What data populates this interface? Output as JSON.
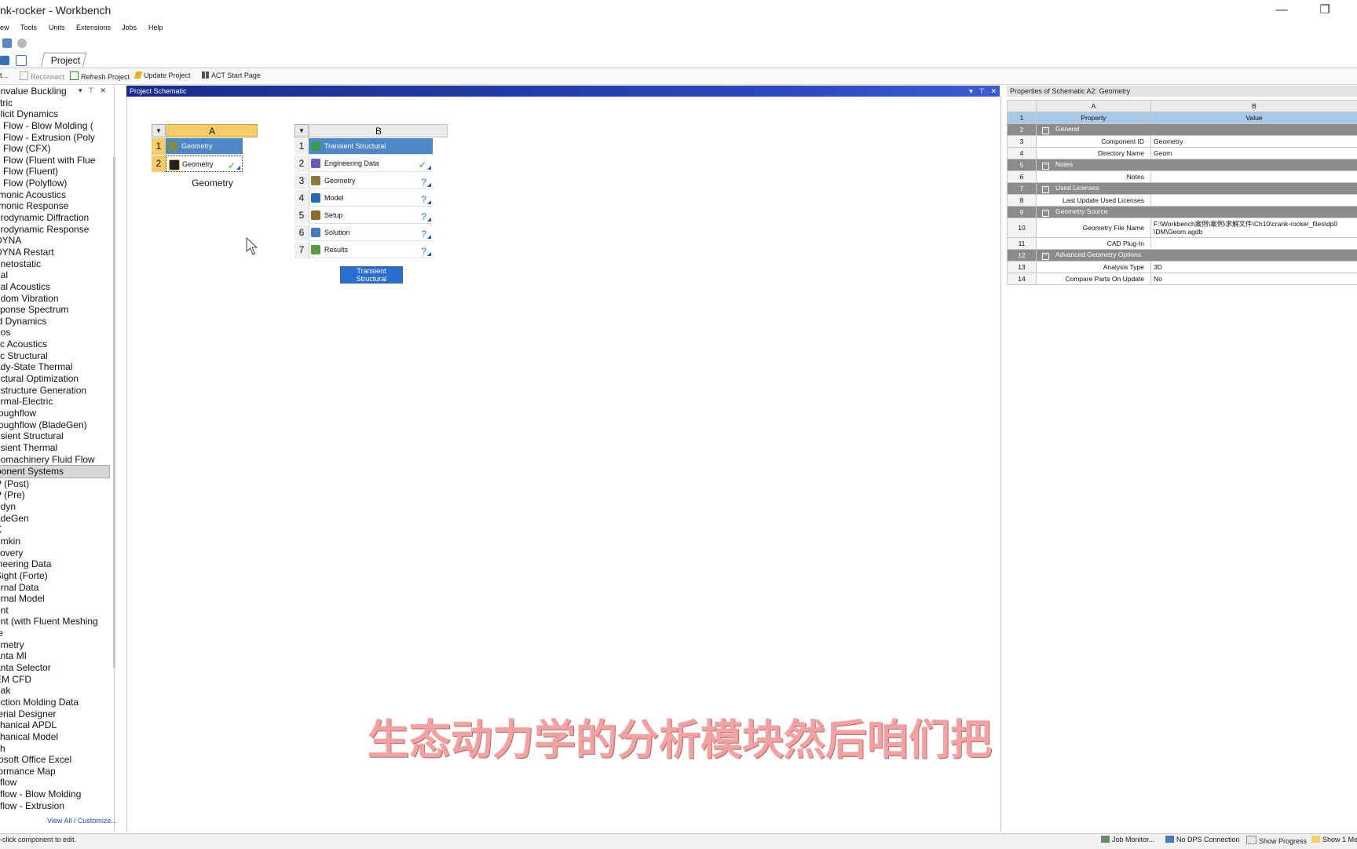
{
  "window": {
    "title": "nk-rocker - Workbench",
    "minimize": "—",
    "restore": "❐"
  },
  "menu": [
    "ew",
    "Tools",
    "Units",
    "Extensions",
    "Jobs",
    "Help"
  ],
  "tabs": {
    "project": "Project"
  },
  "toolbar": {
    "truncated": "t...",
    "reconnect": "Reconnect",
    "refresh": "Refresh Project",
    "update": "Update Project",
    "act": "ACT Start Page"
  },
  "toolbox": {
    "items": [
      {
        "label": "envalue Buckling",
        "group": false
      },
      {
        "label": "ctric",
        "group": false
      },
      {
        "label": "plicit Dynamics",
        "group": false
      },
      {
        "label": "d Flow - Blow Molding (",
        "group": false
      },
      {
        "label": "d Flow - Extrusion (Poly",
        "group": false
      },
      {
        "label": "d Flow (CFX)",
        "group": false
      },
      {
        "label": "d Flow (Fluent with Flue",
        "group": false
      },
      {
        "label": "d Flow (Fluent)",
        "group": false
      },
      {
        "label": "d Flow (Polyflow)",
        "group": false
      },
      {
        "label": "rmonic Acoustics",
        "group": false
      },
      {
        "label": "rmonic Response",
        "group": false
      },
      {
        "label": "drodynamic Diffraction",
        "group": false
      },
      {
        "label": "drodynamic Response",
        "group": false
      },
      {
        "label": "DYNA",
        "group": false
      },
      {
        "label": "DYNA Restart",
        "group": false
      },
      {
        "label": "gnetostatic",
        "group": false
      },
      {
        "label": "dal",
        "group": false
      },
      {
        "label": "dal Acoustics",
        "group": false
      },
      {
        "label": "ndom Vibration",
        "group": false
      },
      {
        "label": "sponse Spectrum",
        "group": false
      },
      {
        "label": "id Dynamics",
        "group": false
      },
      {
        "label": "eos",
        "group": false
      },
      {
        "label": "tic Acoustics",
        "group": false
      },
      {
        "label": "tic Structural",
        "group": false
      },
      {
        "label": "ady-State Thermal",
        "group": false
      },
      {
        "label": "uctural Optimization",
        "group": false
      },
      {
        "label": "ostructure Generation",
        "group": false
      },
      {
        "label": "ermal-Electric",
        "group": false
      },
      {
        "label": "roughflow",
        "group": false
      },
      {
        "label": "roughflow (BladeGen)",
        "group": false
      },
      {
        "label": "nsient Structural",
        "group": false
      },
      {
        "label": "nsient Thermal",
        "group": false
      },
      {
        "label": "bomachinery Fluid Flow",
        "group": false
      },
      {
        "label": "ponent Systems",
        "group": true
      },
      {
        "label": "P (Post)",
        "group": false
      },
      {
        "label": "P (Pre)",
        "group": false
      },
      {
        "label": "odyn",
        "group": false
      },
      {
        "label": "adeGen",
        "group": false
      },
      {
        "label": "X",
        "group": false
      },
      {
        "label": "emkin",
        "group": false
      },
      {
        "label": "covery",
        "group": false
      },
      {
        "label": "ineering Data",
        "group": false
      },
      {
        "label": "Sight (Forte)",
        "group": false
      },
      {
        "label": "ernal Data",
        "group": false
      },
      {
        "label": "ernal Model",
        "group": false
      },
      {
        "label": "ent",
        "group": false
      },
      {
        "label": "ent (with Fluent Meshing",
        "group": false
      },
      {
        "label": "te",
        "group": false
      },
      {
        "label": "ometry",
        "group": false
      },
      {
        "label": "anta MI",
        "group": false
      },
      {
        "label": "anta Selector",
        "group": false
      },
      {
        "label": "EM CFD",
        "group": false
      },
      {
        "label": "oak",
        "group": false
      },
      {
        "label": "ection Molding Data",
        "group": false
      },
      {
        "label": "terial Designer",
        "group": false
      },
      {
        "label": "chanical APDL",
        "group": false
      },
      {
        "label": "chanical Model",
        "group": false
      },
      {
        "label": "sh",
        "group": false
      },
      {
        "label": "rosoft Office Excel",
        "group": false
      },
      {
        "label": "formance Map",
        "group": false
      },
      {
        "label": "yflow",
        "group": false
      },
      {
        "label": "yflow - Blow Molding",
        "group": false
      },
      {
        "label": "yflow - Extrusion",
        "group": false
      }
    ],
    "view_all": "View All / Customize..."
  },
  "schematic": {
    "title": "Project Schematic",
    "systemA": {
      "col": "A",
      "name": "Geometry",
      "rows": [
        {
          "num": "1",
          "label": "Geometry",
          "status": "",
          "icon": "geometry-system-icon"
        },
        {
          "num": "2",
          "label": "Geometry",
          "status": "✓",
          "icon": "geometry-cell-icon"
        }
      ]
    },
    "systemB": {
      "col": "B",
      "name": "Transient Structural",
      "rows": [
        {
          "num": "1",
          "label": "Transient Structural",
          "status": "",
          "icon": "transient-structural-icon"
        },
        {
          "num": "2",
          "label": "Engineering Data",
          "status": "✓",
          "icon": "engineering-data-icon"
        },
        {
          "num": "3",
          "label": "Geometry",
          "status": "?",
          "icon": "geometry-cell-icon"
        },
        {
          "num": "4",
          "label": "Model",
          "status": "?",
          "icon": "model-icon"
        },
        {
          "num": "5",
          "label": "Setup",
          "status": "?",
          "icon": "setup-icon"
        },
        {
          "num": "6",
          "label": "Solution",
          "status": "?",
          "icon": "solution-icon"
        },
        {
          "num": "7",
          "label": "Results",
          "status": "?",
          "icon": "results-icon"
        }
      ]
    }
  },
  "properties": {
    "title": "Properties of Schematic A2: Geometry",
    "col_a": "A",
    "col_b": "B",
    "header": {
      "num": "1",
      "property": "Property",
      "value": "Value"
    },
    "rows": [
      {
        "num": "2",
        "type": "cat",
        "label": "General",
        "value": ""
      },
      {
        "num": "3",
        "type": "prop",
        "label": "Component ID",
        "value": "Geometry"
      },
      {
        "num": "4",
        "type": "prop",
        "label": "Directory Name",
        "value": "Geom"
      },
      {
        "num": "5",
        "type": "cat",
        "label": "Notes",
        "value": ""
      },
      {
        "num": "6",
        "type": "prop",
        "label": "Notes",
        "value": ""
      },
      {
        "num": "7",
        "type": "cat",
        "label": "Used Licenses",
        "value": ""
      },
      {
        "num": "8",
        "type": "prop",
        "label": "Last Update Used Licenses",
        "value": ""
      },
      {
        "num": "9",
        "type": "cat",
        "label": "Geometry Source",
        "value": ""
      },
      {
        "num": "10",
        "type": "prop2",
        "label": "Geometry File Name",
        "value": "F:\\Workbench案例\\案例\\求解文件\\Ch10\\crank-rocker_files\\dp0",
        "value2": "\\DM\\Geom.agdb"
      },
      {
        "num": "11",
        "type": "prop",
        "label": "CAD Plug-In",
        "value": ""
      },
      {
        "num": "12",
        "type": "cat",
        "label": "Advanced Geometry Options",
        "value": ""
      },
      {
        "num": "13",
        "type": "prop",
        "label": "Analysis Type",
        "value": "3D"
      },
      {
        "num": "14",
        "type": "prop",
        "label": "Compare Parts On Update",
        "value": "No"
      }
    ]
  },
  "statusbar": {
    "text": "-click component to edit.",
    "job_monitor": "Job Monitor...",
    "dps": "No DPS Connection",
    "progress": "Show Progress",
    "show": "Show 1 Me"
  },
  "subtitle": "生态动力学的分析模块然后咱们把"
}
